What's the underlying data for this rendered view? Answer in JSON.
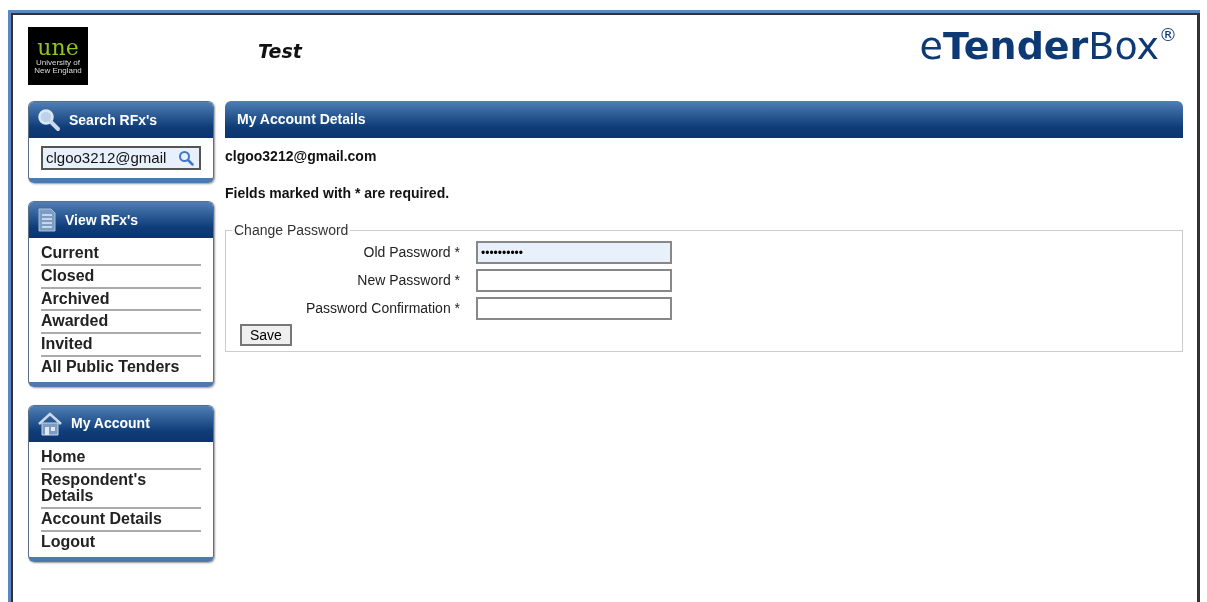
{
  "header": {
    "logo": {
      "mark": "une",
      "caption": "University of New England"
    },
    "title": "Test",
    "brand": "e**Tender**Box$^{®}$"
  },
  "sidebar": [
    {
      "kind": "search",
      "title": "Search RFx's",
      "value": "clgoo3212@gmail"
    },
    {
      "kind": "links",
      "title": "View RFx's",
      "items": [
        "Current",
        "Closed",
        "Archived",
        "Awarded",
        "Invited",
        "All Public Tenders"
      ]
    },
    {
      "kind": "links",
      "title": "My Account",
      "items": [
        "Home",
        "Respondent's Details",
        "Account Details",
        "Logout"
      ]
    }
  ],
  "main": {
    "title": "My Account Details",
    "email": "clgoo3212@gmail.com",
    "note": "Fields marked with * are required.",
    "fieldset": {
      "legend": "Change Password",
      "fields": [
        {
          "label": "Old Password *",
          "value": "••••••••••",
          "focused": true
        },
        {
          "label": "New Password *",
          "focused": false
        },
        {
          "label": "Password Confirmation *",
          "focused": false
        }
      ],
      "button": "Save"
    }
  }
}
